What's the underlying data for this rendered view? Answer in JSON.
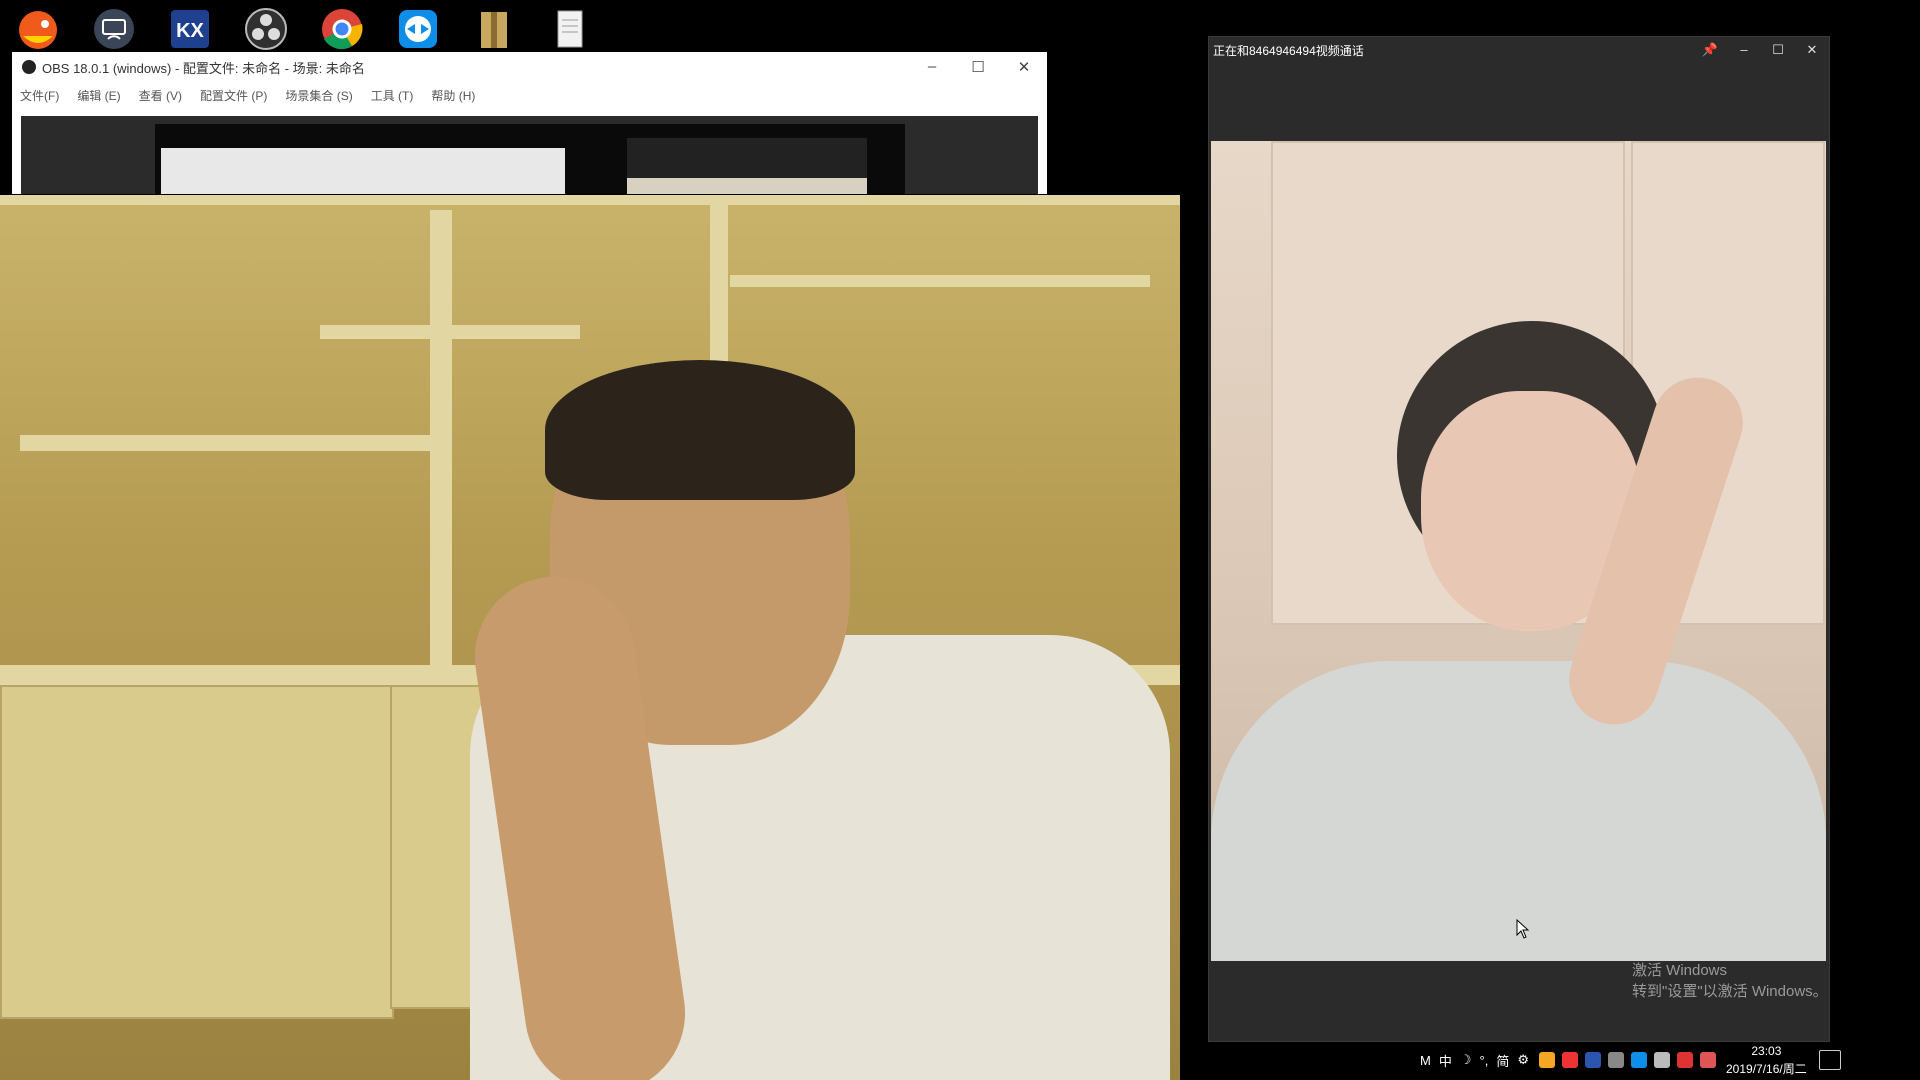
{
  "desktop_icons": [
    {
      "name": "game-app-icon",
      "color": "#f05a1a"
    },
    {
      "name": "wireless-display-icon",
      "color": "#5a6a80"
    },
    {
      "name": "kx-app-icon",
      "color": "#2050b0"
    },
    {
      "name": "obs-icon",
      "color": "#333333"
    },
    {
      "name": "chrome-icon",
      "color": "#2fa84f"
    },
    {
      "name": "teamviewer-icon",
      "color": "#0e8ee9"
    },
    {
      "name": "folder-archive-icon",
      "color": "#c8a860"
    },
    {
      "name": "text-document-icon",
      "color": "#eeeeee"
    }
  ],
  "obs": {
    "title": "OBS 18.0.1 (windows) - 配置文件: 未命名 - 场景: 未命名",
    "controls": {
      "minimize": "–",
      "maximize": "☐",
      "close": "✕"
    },
    "menu": [
      "文件(F)",
      "编辑 (E)",
      "查看 (V)",
      "配置文件 (P)",
      "场景集合 (S)",
      "工具 (T)",
      "帮助 (H)"
    ]
  },
  "call": {
    "title": "正在和8464946494视频通话",
    "controls": {
      "pin": "📌",
      "minimize": "–",
      "maximize": "☐",
      "close": "✕"
    }
  },
  "watermark": {
    "line1": "激活 Windows",
    "line2": "转到\"设置\"以激活 Windows。"
  },
  "taskbar": {
    "ime": [
      "M",
      "中",
      "☽",
      "°,",
      "简",
      "⚙"
    ],
    "time": "23:03",
    "date": "2019/7/16/周二"
  }
}
